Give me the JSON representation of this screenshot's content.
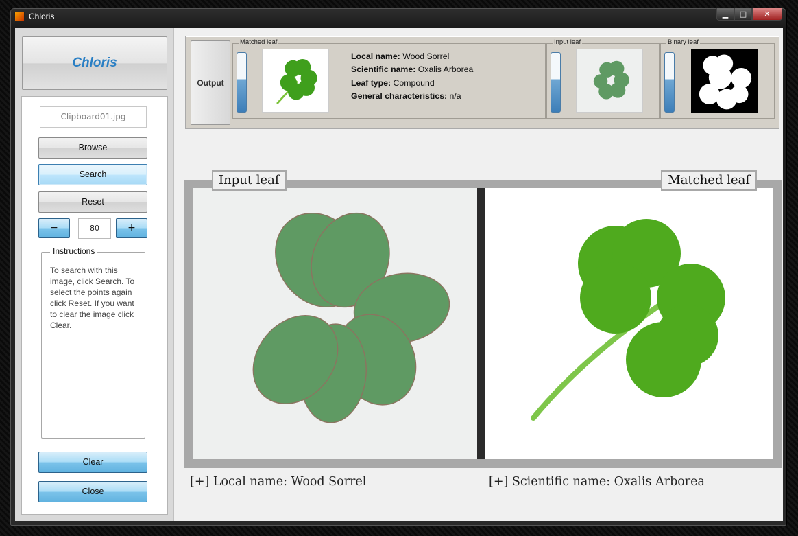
{
  "window": {
    "title": "Chloris",
    "controls": {
      "minimize": "▁",
      "maximize": "□",
      "close": "✕"
    }
  },
  "sidebar": {
    "logo": "Chloris",
    "file_name": "Clipboard01.jpg",
    "buttons": {
      "browse": "Browse",
      "search": "Search",
      "reset": "Reset",
      "minus": "−",
      "plus": "+",
      "clear": "Clear",
      "close": "Close"
    },
    "threshold_value": "80",
    "instructions": {
      "title": "Instructions",
      "text": "To search with this image, click Search. To select the points again click Reset. If you want to clear the image click Clear."
    }
  },
  "output": {
    "button_label": "Output",
    "matched_leaf": {
      "title": "Matched leaf",
      "fields": [
        {
          "label": "Local name:",
          "value": "Wood Sorrel"
        },
        {
          "label": "Scientific name:",
          "value": "Oxalis Arborea"
        },
        {
          "label": "Leaf type:",
          "value": "Compound"
        },
        {
          "label": "General characteristics:",
          "value": "n/a"
        }
      ]
    },
    "input_leaf": {
      "title": "Input leaf"
    },
    "binary_leaf": {
      "title": "Binary leaf"
    }
  },
  "viewer": {
    "left_label": "Input leaf",
    "right_label": "Matched leaf",
    "left_caption": "[+] Local name: Wood Sorrel",
    "right_caption": "[+] Scientific name: Oxalis Arborea"
  },
  "colors": {
    "accent_blue": "#2a7fc4",
    "input_leaf_green": "#5f9a63",
    "matched_leaf_green": "#4faa1e"
  }
}
